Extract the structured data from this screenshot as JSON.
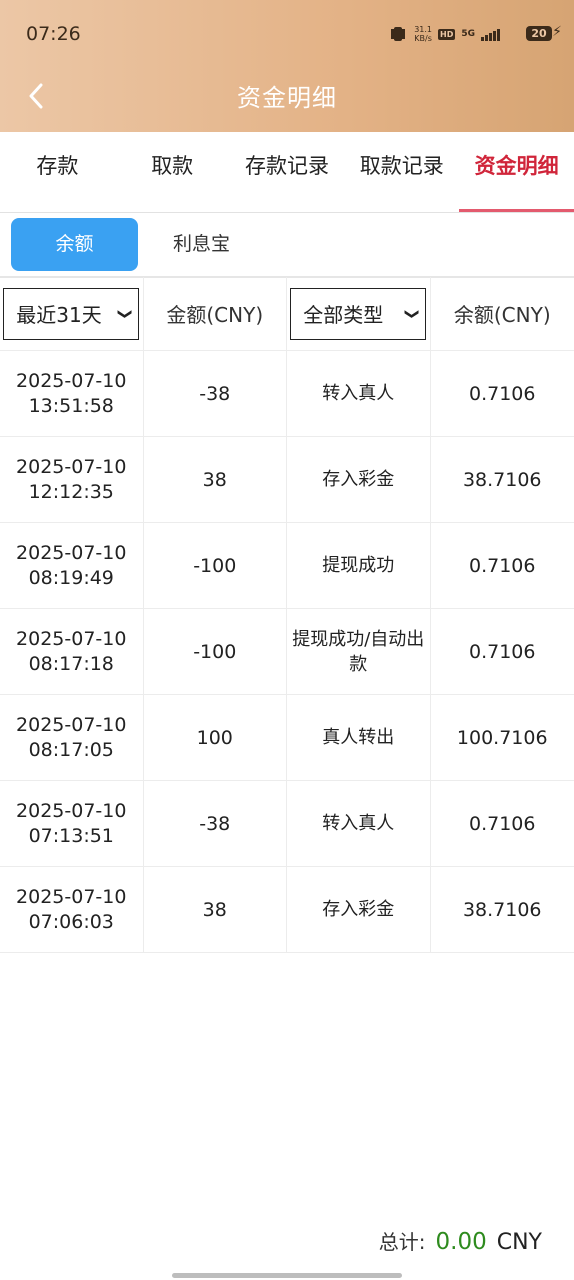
{
  "status_bar": {
    "time": "07:26",
    "speed": "31.1\nKB/s",
    "network": "5G",
    "battery": "20"
  },
  "header": {
    "title": "资金明细"
  },
  "main_tabs": [
    {
      "label": "存款",
      "active": false
    },
    {
      "label": "取款",
      "active": false
    },
    {
      "label": "存款记录",
      "active": false
    },
    {
      "label": "取款记录",
      "active": false
    },
    {
      "label": "资金明细",
      "active": true
    }
  ],
  "sub_tabs": [
    {
      "label": "余额",
      "active": true
    },
    {
      "label": "利息宝",
      "active": false
    }
  ],
  "table": {
    "filters": {
      "period_selected": "最近31天",
      "type_selected": "全部类型"
    },
    "headers": {
      "amount": "金额(CNY)",
      "balance": "余额(CNY)"
    },
    "rows": [
      {
        "date": "2025-07-10",
        "time": "13:51:58",
        "amount": "-38",
        "type": "转入真人",
        "balance": "0.7106"
      },
      {
        "date": "2025-07-10",
        "time": "12:12:35",
        "amount": "38",
        "type": "存入彩金",
        "balance": "38.7106"
      },
      {
        "date": "2025-07-10",
        "time": "08:19:49",
        "amount": "-100",
        "type": "提现成功",
        "balance": "0.7106"
      },
      {
        "date": "2025-07-10",
        "time": "08:17:18",
        "amount": "-100",
        "type": "提现成功/自动出款",
        "balance": "0.7106"
      },
      {
        "date": "2025-07-10",
        "time": "08:17:05",
        "amount": "100",
        "type": "真人转出",
        "balance": "100.7106"
      },
      {
        "date": "2025-07-10",
        "time": "07:13:51",
        "amount": "-38",
        "type": "转入真人",
        "balance": "0.7106"
      },
      {
        "date": "2025-07-10",
        "time": "07:06:03",
        "amount": "38",
        "type": "存入彩金",
        "balance": "38.7106"
      }
    ]
  },
  "footer": {
    "total_label": "总计:",
    "total_amount": "0.00",
    "currency": "CNY"
  },
  "colors": {
    "header_start": "#ecc7a6",
    "header_end": "#d6a473",
    "active_tab": "#d0253a",
    "active_sub_tab": "#3aa1f2",
    "total_amount": "#2e8b1e"
  }
}
